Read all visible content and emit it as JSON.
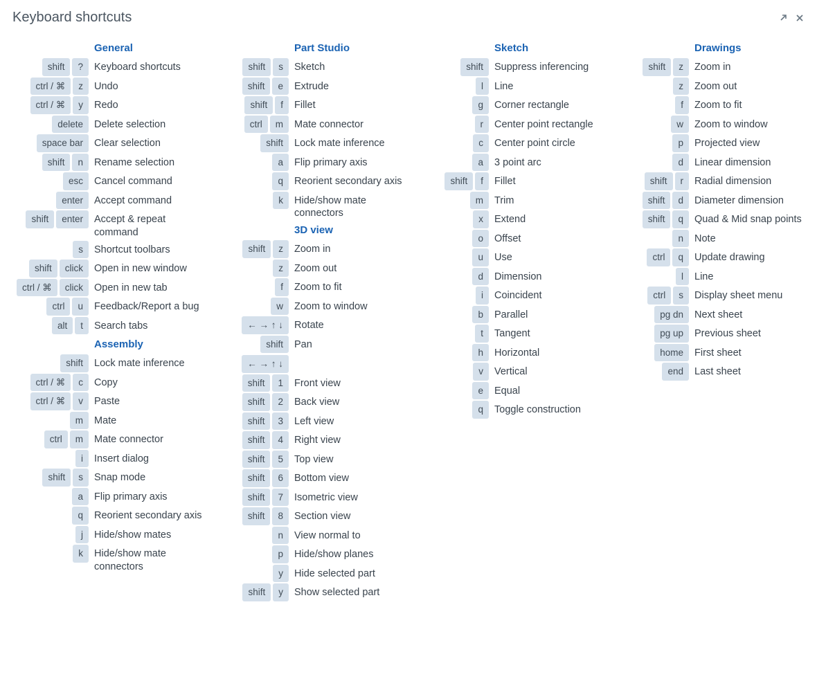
{
  "title": "Keyboard shortcuts",
  "columns": [
    [
      {
        "heading": "General",
        "items": [
          {
            "keys": [
              "shift",
              "?"
            ],
            "desc": "Keyboard shortcuts"
          },
          {
            "keys": [
              "ctrl / ⌘",
              "z"
            ],
            "desc": "Undo"
          },
          {
            "keys": [
              "ctrl / ⌘",
              "y"
            ],
            "desc": "Redo"
          },
          {
            "keys": [
              "delete"
            ],
            "desc": "Delete selection"
          },
          {
            "keys": [
              "space bar"
            ],
            "desc": "Clear selection"
          },
          {
            "keys": [
              "shift",
              "n"
            ],
            "desc": "Rename selection"
          },
          {
            "keys": [
              "esc"
            ],
            "desc": "Cancel command"
          },
          {
            "keys": [
              "enter"
            ],
            "desc": "Accept command"
          },
          {
            "keys": [
              "shift",
              "enter"
            ],
            "desc": "Accept & repeat command"
          },
          {
            "keys": [
              "s"
            ],
            "desc": "Shortcut toolbars"
          },
          {
            "keys": [
              "shift",
              "click"
            ],
            "desc": "Open in new window"
          },
          {
            "keys": [
              "ctrl / ⌘",
              "click"
            ],
            "desc": "Open in new tab"
          },
          {
            "keys": [
              "ctrl",
              "u"
            ],
            "desc": "Feedback/Report a bug"
          },
          {
            "keys": [
              "alt",
              "t"
            ],
            "desc": "Search tabs"
          }
        ]
      },
      {
        "heading": "Assembly",
        "items": [
          {
            "keys": [
              "shift"
            ],
            "desc": "Lock mate inference"
          },
          {
            "keys": [
              "ctrl / ⌘",
              "c"
            ],
            "desc": "Copy"
          },
          {
            "keys": [
              "ctrl / ⌘",
              "v"
            ],
            "desc": "Paste"
          },
          {
            "keys": [
              "m"
            ],
            "desc": "Mate"
          },
          {
            "keys": [
              "ctrl",
              "m"
            ],
            "desc": "Mate connector"
          },
          {
            "keys": [
              "i"
            ],
            "desc": "Insert dialog"
          },
          {
            "keys": [
              "shift",
              "s"
            ],
            "desc": "Snap mode"
          },
          {
            "keys": [
              "a"
            ],
            "desc": "Flip primary axis"
          },
          {
            "keys": [
              "q"
            ],
            "desc": "Reorient secondary axis"
          },
          {
            "keys": [
              "j"
            ],
            "desc": "Hide/show mates"
          },
          {
            "keys": [
              "k"
            ],
            "desc": "Hide/show mate connectors"
          }
        ]
      }
    ],
    [
      {
        "heading": "Part Studio",
        "items": [
          {
            "keys": [
              "shift",
              "s"
            ],
            "desc": "Sketch"
          },
          {
            "keys": [
              "shift",
              "e"
            ],
            "desc": "Extrude"
          },
          {
            "keys": [
              "shift",
              "f"
            ],
            "desc": "Fillet"
          },
          {
            "keys": [
              "ctrl",
              "m"
            ],
            "desc": "Mate connector"
          },
          {
            "keys": [
              "shift"
            ],
            "desc": "Lock mate inference"
          },
          {
            "keys": [
              "a"
            ],
            "desc": "Flip primary axis"
          },
          {
            "keys": [
              "q"
            ],
            "desc": "Reorient secondary axis"
          },
          {
            "keys": [
              "k"
            ],
            "desc": "Hide/show mate connectors"
          }
        ]
      },
      {
        "heading": "3D view",
        "items": [
          {
            "keys": [
              "shift",
              "z"
            ],
            "desc": "Zoom in"
          },
          {
            "keys": [
              "z"
            ],
            "desc": "Zoom out"
          },
          {
            "keys": [
              "f"
            ],
            "desc": "Zoom to fit"
          },
          {
            "keys": [
              "w"
            ],
            "desc": "Zoom to window"
          },
          {
            "keys": [
              "← → ↑ ↓"
            ],
            "desc": "Rotate"
          },
          {
            "keys": [
              "shift",
              "← → ↑ ↓"
            ],
            "desc": "Pan"
          },
          {
            "keys": [
              "shift",
              "1"
            ],
            "desc": "Front view"
          },
          {
            "keys": [
              "shift",
              "2"
            ],
            "desc": "Back view"
          },
          {
            "keys": [
              "shift",
              "3"
            ],
            "desc": "Left view"
          },
          {
            "keys": [
              "shift",
              "4"
            ],
            "desc": "Right view"
          },
          {
            "keys": [
              "shift",
              "5"
            ],
            "desc": "Top view"
          },
          {
            "keys": [
              "shift",
              "6"
            ],
            "desc": "Bottom view"
          },
          {
            "keys": [
              "shift",
              "7"
            ],
            "desc": "Isometric view"
          },
          {
            "keys": [
              "shift",
              "8"
            ],
            "desc": "Section view"
          },
          {
            "keys": [
              "n"
            ],
            "desc": "View normal to"
          },
          {
            "keys": [
              "p"
            ],
            "desc": "Hide/show planes"
          },
          {
            "keys": [
              "y"
            ],
            "desc": "Hide selected part"
          },
          {
            "keys": [
              "shift",
              "y"
            ],
            "desc": "Show selected part"
          }
        ]
      }
    ],
    [
      {
        "heading": "Sketch",
        "items": [
          {
            "keys": [
              "shift"
            ],
            "desc": "Suppress inferencing"
          },
          {
            "keys": [
              "l"
            ],
            "desc": "Line"
          },
          {
            "keys": [
              "g"
            ],
            "desc": "Corner rectangle"
          },
          {
            "keys": [
              "r"
            ],
            "desc": "Center point rectangle"
          },
          {
            "keys": [
              "c"
            ],
            "desc": "Center point circle"
          },
          {
            "keys": [
              "a"
            ],
            "desc": "3 point arc"
          },
          {
            "keys": [
              "shift",
              "f"
            ],
            "desc": "Fillet"
          },
          {
            "keys": [
              "m"
            ],
            "desc": "Trim"
          },
          {
            "keys": [
              "x"
            ],
            "desc": "Extend"
          },
          {
            "keys": [
              "o"
            ],
            "desc": "Offset"
          },
          {
            "keys": [
              "u"
            ],
            "desc": "Use"
          },
          {
            "keys": [
              "d"
            ],
            "desc": "Dimension"
          },
          {
            "keys": [
              "i"
            ],
            "desc": "Coincident"
          },
          {
            "keys": [
              "b"
            ],
            "desc": "Parallel"
          },
          {
            "keys": [
              "t"
            ],
            "desc": "Tangent"
          },
          {
            "keys": [
              "h"
            ],
            "desc": "Horizontal"
          },
          {
            "keys": [
              "v"
            ],
            "desc": "Vertical"
          },
          {
            "keys": [
              "e"
            ],
            "desc": "Equal"
          },
          {
            "keys": [
              "q"
            ],
            "desc": "Toggle construction"
          }
        ]
      }
    ],
    [
      {
        "heading": "Drawings",
        "items": [
          {
            "keys": [
              "shift",
              "z"
            ],
            "desc": "Zoom in"
          },
          {
            "keys": [
              "z"
            ],
            "desc": "Zoom out"
          },
          {
            "keys": [
              "f"
            ],
            "desc": "Zoom to fit"
          },
          {
            "keys": [
              "w"
            ],
            "desc": "Zoom to window"
          },
          {
            "keys": [
              "p"
            ],
            "desc": "Projected view"
          },
          {
            "keys": [
              "d"
            ],
            "desc": "Linear dimension"
          },
          {
            "keys": [
              "shift",
              "r"
            ],
            "desc": "Radial dimension"
          },
          {
            "keys": [
              "shift",
              "d"
            ],
            "desc": "Diameter dimension"
          },
          {
            "keys": [
              "shift",
              "q"
            ],
            "desc": "Quad & Mid snap points"
          },
          {
            "keys": [
              "n"
            ],
            "desc": "Note"
          },
          {
            "keys": [
              "ctrl",
              "q"
            ],
            "desc": "Update drawing"
          },
          {
            "keys": [
              "l"
            ],
            "desc": "Line"
          },
          {
            "keys": [
              "ctrl",
              "s"
            ],
            "desc": "Display sheet menu"
          },
          {
            "keys": [
              "pg dn"
            ],
            "desc": "Next sheet"
          },
          {
            "keys": [
              "pg up"
            ],
            "desc": "Previous sheet"
          },
          {
            "keys": [
              "home"
            ],
            "desc": "First sheet"
          },
          {
            "keys": [
              "end"
            ],
            "desc": "Last sheet"
          }
        ]
      }
    ]
  ]
}
